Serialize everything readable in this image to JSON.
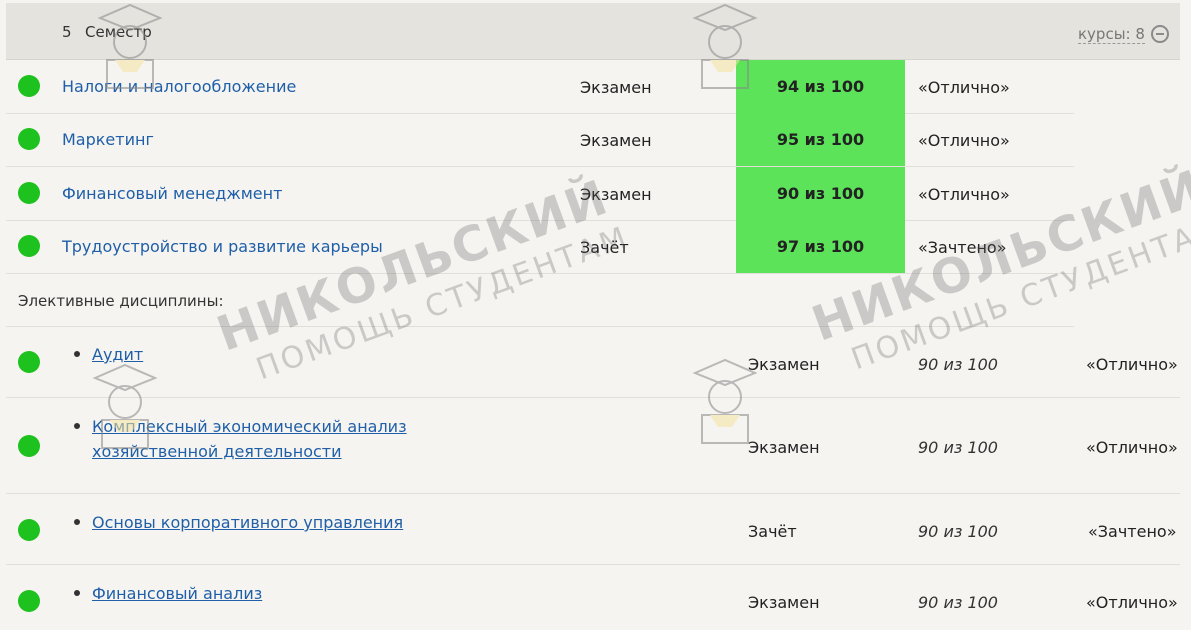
{
  "semester": {
    "number": "5",
    "label": "Семестр",
    "courses_count": "курсы: 8"
  },
  "courses": [
    {
      "name": "Налоги и налогообложение",
      "control": "Экзамен",
      "score": "94 из 100",
      "grade": "«Отлично»"
    },
    {
      "name": "Маркетинг",
      "control": "Экзамен",
      "score": "95 из 100",
      "grade": "«Отлично»"
    },
    {
      "name": "Финансовый менеджмент",
      "control": "Экзамен",
      "score": "90 из 100",
      "grade": "«Отлично»"
    },
    {
      "name": "Трудоустройство и развитие карьеры",
      "control": "Зачёт",
      "score": "97 из 100",
      "grade": "«Зачтено»"
    }
  ],
  "electives_title": "Элективные дисциплины:",
  "electives": [
    {
      "name": "Аудит",
      "control": "Экзамен",
      "score": "90 из 100",
      "grade": "«Отлично»"
    },
    {
      "name": "Комплексный экономический анализ хозяйственной деятельности",
      "control": "Экзамен",
      "score": "90 из 100",
      "grade": "«Отлично»"
    },
    {
      "name": "Основы корпоративного управления",
      "control": "Зачёт",
      "score": "90 из 100",
      "grade": "«Зачтено»"
    },
    {
      "name": "Финансовый анализ",
      "control": "Экзамен",
      "score": "90 из 100",
      "grade": "«Отлично»"
    }
  ],
  "watermark": {
    "title": "НИКОЛЬСКИЙ",
    "subtitle": "ПОМОЩЬ СТУДЕНТАМ"
  },
  "colors": {
    "status_green": "#1ec21e",
    "score_highlight": "#5de35a",
    "link": "#1f5fa8"
  },
  "icons": {
    "collapse": "minus-circle-icon",
    "status": "status-dot-icon"
  }
}
